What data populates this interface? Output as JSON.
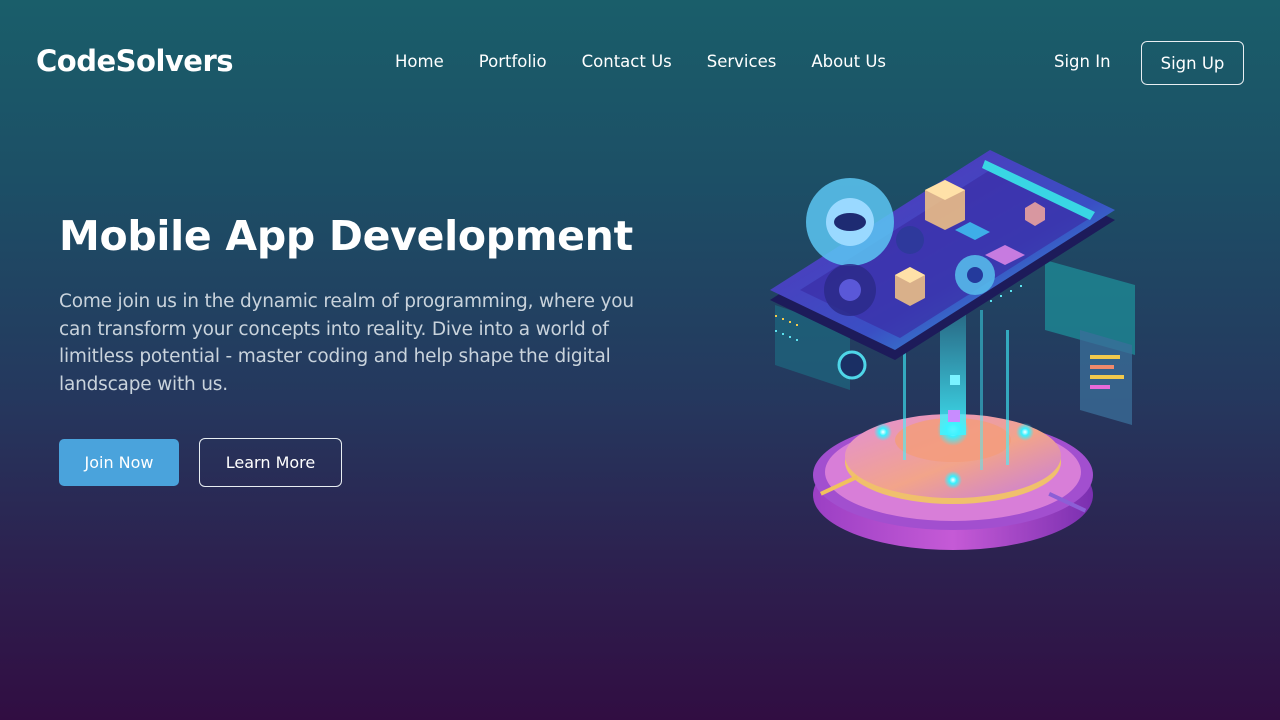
{
  "brand": {
    "name": "CodeSolvers"
  },
  "nav": {
    "items": [
      {
        "label": "Home"
      },
      {
        "label": "Portfolio"
      },
      {
        "label": "Contact Us"
      },
      {
        "label": "Services"
      },
      {
        "label": "About Us"
      }
    ],
    "sign_in": "Sign In",
    "sign_up": "Sign Up"
  },
  "hero": {
    "title": "Mobile App Development",
    "description": "Come join us in the dynamic realm of programming, where you can transform your concepts into reality. Dive into a world of limitless potential - master coding and help shape the digital landscape with us.",
    "primary_button": "Join Now",
    "secondary_button": "Learn More",
    "illustration": "isometric-mobile-app-illustration"
  },
  "colors": {
    "primary_button": "#4aa3dc",
    "background_top": "#1a5e6a",
    "background_bottom": "#310d42"
  }
}
